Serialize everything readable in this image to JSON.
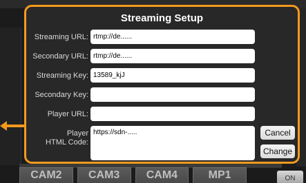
{
  "dialog": {
    "title": "Streaming Setup",
    "fields": [
      {
        "label": "Streaming URL:",
        "value": "rtmp://de......"
      },
      {
        "label": "Secondary URL:",
        "value": "rtmp://de......"
      },
      {
        "label": "Streaming Key:",
        "value": "13589_kjJ"
      },
      {
        "label": "Secondary Key:",
        "value": ""
      },
      {
        "label": "Player URL:",
        "value": ""
      },
      {
        "label_line1": "Player",
        "label_line2": "HTML Code:",
        "value": "https://sdn-....."
      }
    ],
    "cancel_label": "Cancel",
    "change_label": "Change"
  },
  "bottom_bar": {
    "cams": [
      "CAM2",
      "CAM3",
      "CAM4",
      "MP1"
    ],
    "on_label": "ON"
  },
  "colors": {
    "accent": "#f39a1e",
    "dialog_bg": "#282828"
  }
}
